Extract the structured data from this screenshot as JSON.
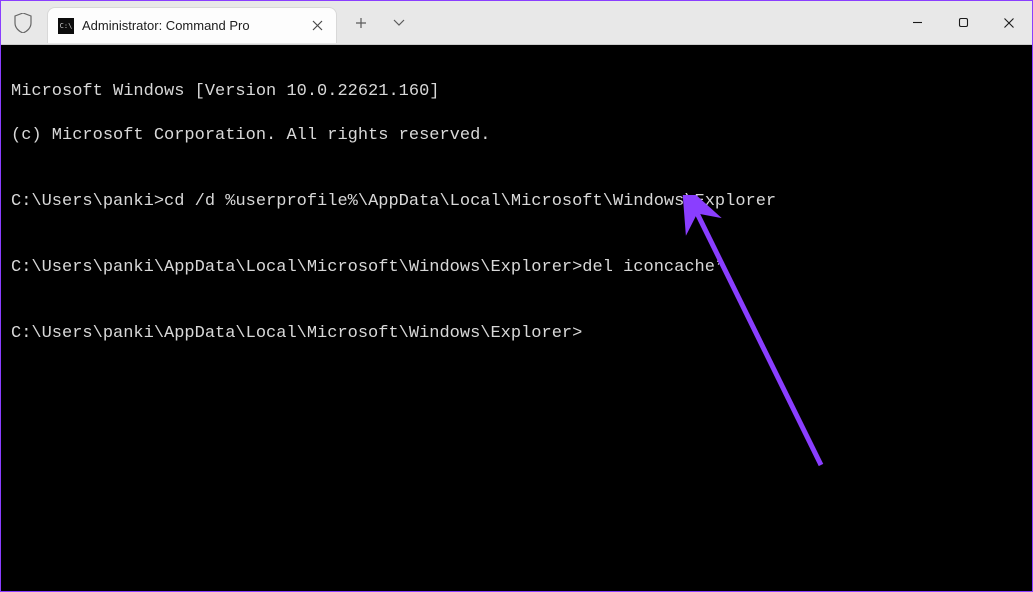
{
  "tab": {
    "title": "Administrator: Command Pro"
  },
  "terminal": {
    "line1": "Microsoft Windows [Version 10.0.22621.160]",
    "line2": "(c) Microsoft Corporation. All rights reserved.",
    "blank1": "",
    "line3_prompt": "C:\\Users\\panki>",
    "line3_cmd": "cd /d %userprofile%\\AppData\\Local\\Microsoft\\Windows\\Explorer",
    "blank2": "",
    "line4_prompt": "C:\\Users\\panki\\AppData\\Local\\Microsoft\\Windows\\Explorer>",
    "line4_cmd": "del iconcache*",
    "blank3": "",
    "line5_prompt": "C:\\Users\\panki\\AppData\\Local\\Microsoft\\Windows\\Explorer>"
  },
  "colors": {
    "arrow": "#8a3eff"
  }
}
